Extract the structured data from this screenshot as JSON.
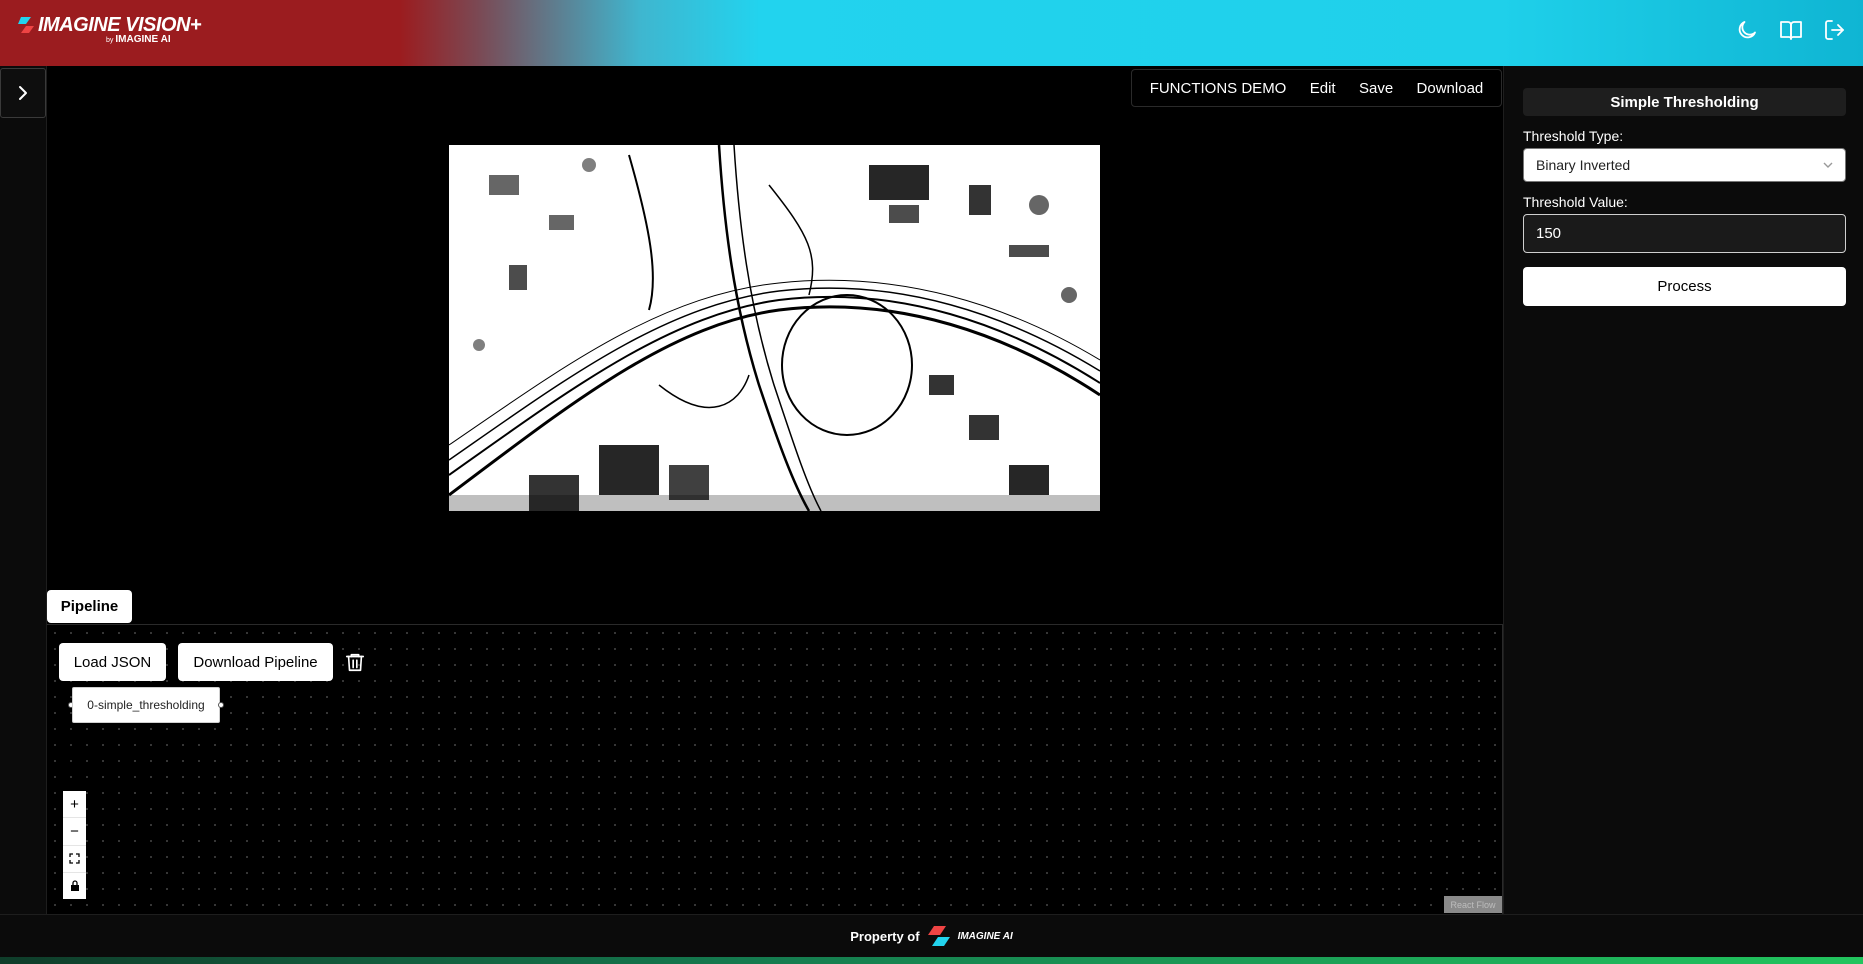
{
  "header": {
    "logo_title": "IMAGINE VISION+",
    "logo_by": "by",
    "logo_sub": "IMAGINE AI",
    "icons": [
      "moon-icon",
      "book-icon",
      "logout-icon"
    ]
  },
  "toolbar": {
    "project_name": "FUNCTIONS DEMO",
    "edit_label": "Edit",
    "save_label": "Save",
    "download_label": "Download"
  },
  "pipeline": {
    "tab_label": "Pipeline",
    "load_json_label": "Load JSON",
    "download_pipeline_label": "Download Pipeline",
    "node_label": "0-simple_thresholding",
    "attribution": "React Flow"
  },
  "zoom_controls": {
    "zoom_in": "+",
    "zoom_out": "−"
  },
  "panel": {
    "title": "Simple Thresholding",
    "threshold_type_label": "Threshold Type:",
    "threshold_type_value": "Binary Inverted",
    "threshold_value_label": "Threshold Value:",
    "threshold_value": "150",
    "process_label": "Process"
  },
  "footer": {
    "property_text": "Property of",
    "brand": "IMAGINE AI"
  },
  "colors": {
    "header_left": "#9b1c1f",
    "header_right": "#22d3ee",
    "background": "#000000",
    "panel": "#0b0b0b"
  }
}
